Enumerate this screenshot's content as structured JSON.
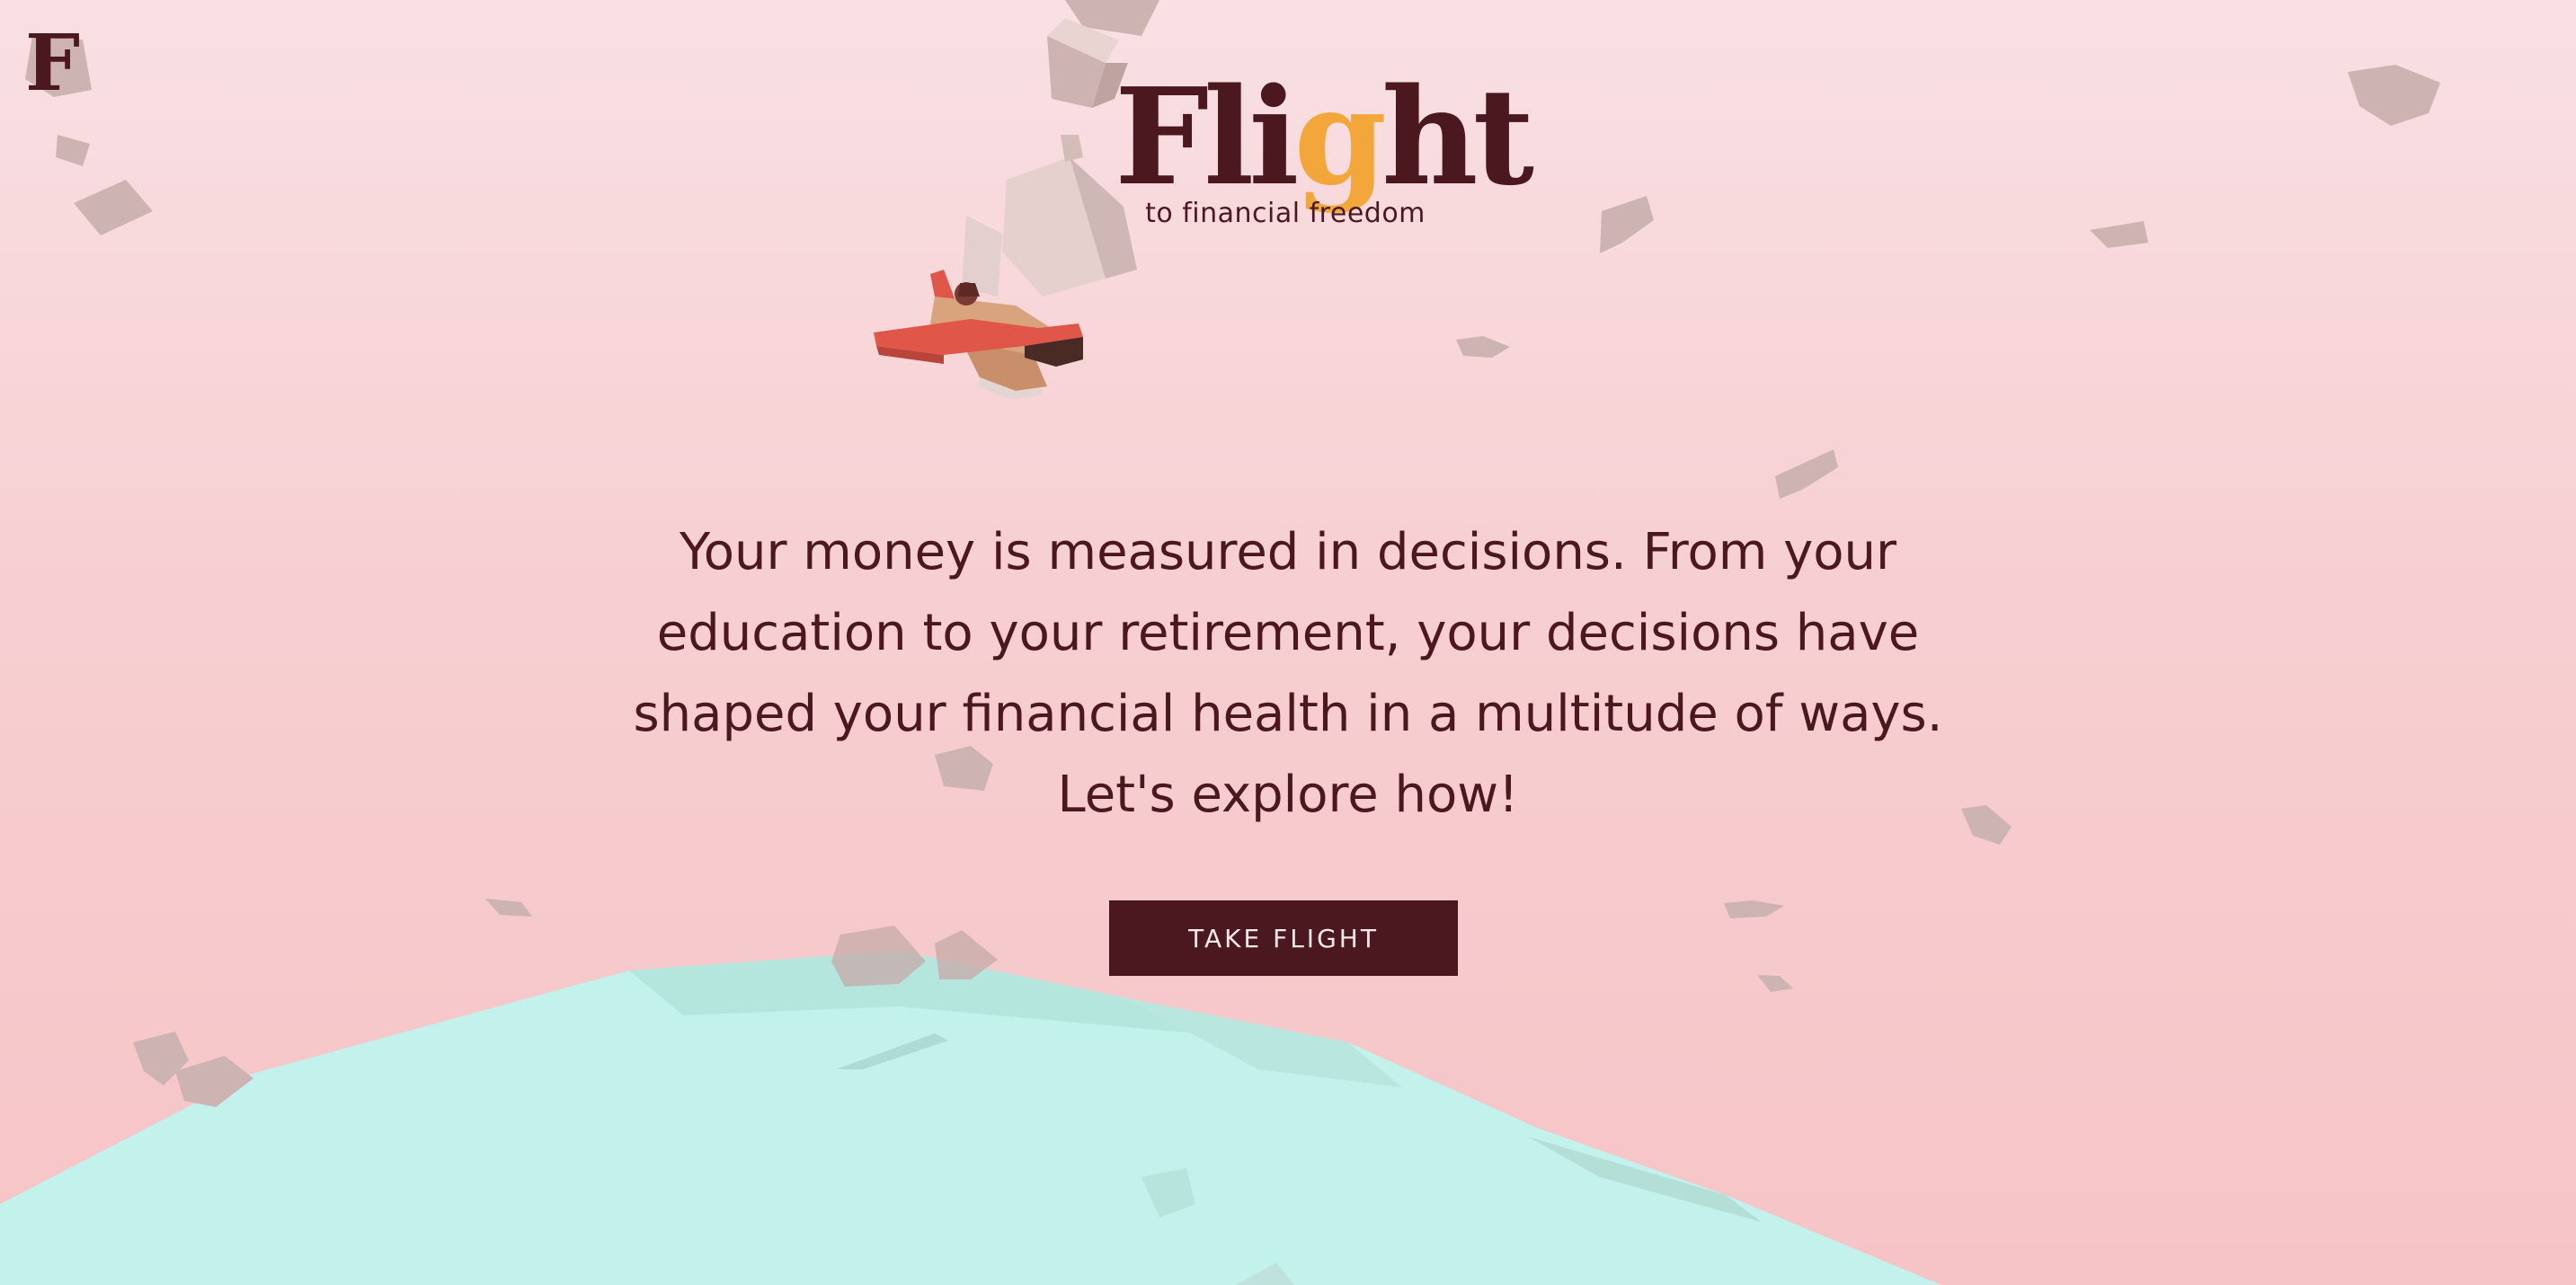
{
  "corner_logo": {
    "letter": "F"
  },
  "brand": {
    "title_prefix": "Fli",
    "title_highlight": "g",
    "title_suffix": "ht",
    "tagline": "to financial freedom"
  },
  "hero": {
    "lines": [
      "Your money is measured in decisions. From your",
      "education to your retirement, your decisions have",
      "shaped your financial health in a multitude of ways.",
      "Let's explore how!"
    ]
  },
  "cta": {
    "label": "TAKE FLIGHT"
  },
  "colors": {
    "sky_top": "#f9e0e3",
    "sky_bottom": "#f6c4c6",
    "ground": "#c3f2ed",
    "text_dark": "#4b1820",
    "accent": "#f3a73b",
    "plane_red": "#e0574a",
    "plane_wood": "#d9a37e",
    "rock": "#cdb3b1"
  },
  "icons": {
    "plane": "biplane-icon",
    "rocks": "floating-rock-icon"
  }
}
